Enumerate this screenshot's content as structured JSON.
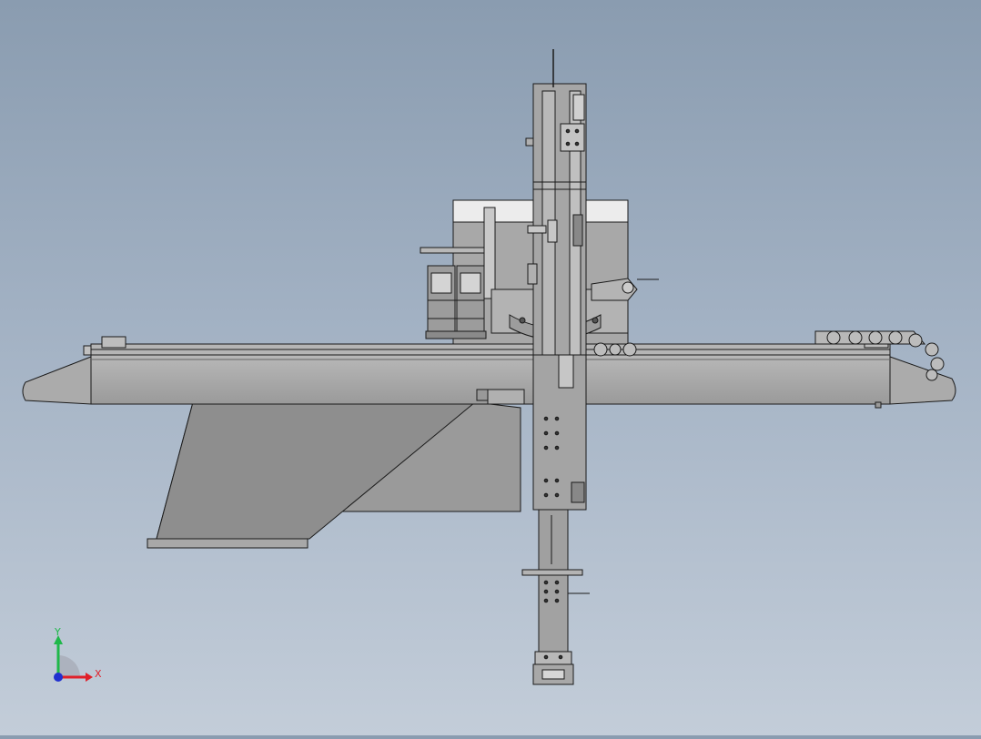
{
  "view": {
    "background_top": "#8a9cb0",
    "background_bottom": "#c3cdd9",
    "model_fill": "#a9a9a9",
    "model_fill_dark": "#8f8f8f",
    "model_fill_light": "#c2c2c2",
    "edge_color": "#1a1a1a"
  },
  "triad": {
    "x_label": "X",
    "y_label": "Y",
    "x_color": "#e0202a",
    "y_color": "#1fb84a",
    "z_color": "#2030d0"
  }
}
